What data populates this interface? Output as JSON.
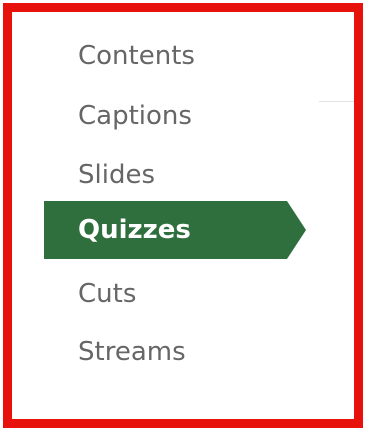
{
  "nav": {
    "items": [
      {
        "label": "Contents",
        "active": false
      },
      {
        "label": "Captions",
        "active": false
      },
      {
        "label": "Slides",
        "active": false
      },
      {
        "label": "Quizzes",
        "active": true
      },
      {
        "label": "Cuts",
        "active": false
      },
      {
        "label": "Streams",
        "active": false
      }
    ]
  },
  "colors": {
    "frame_border": "#e8120c",
    "active_bg": "#2f6f3d",
    "active_text": "#ffffff",
    "inactive_text": "#666666"
  }
}
